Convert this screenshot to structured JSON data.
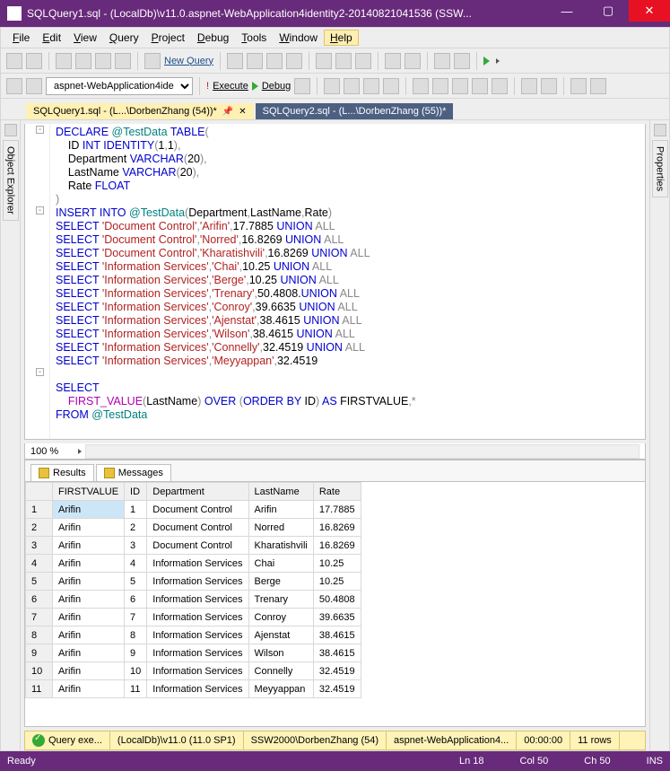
{
  "title": "SQLQuery1.sql - (LocalDb)\\v11.0.aspnet-WebApplication4identity2-20140821041536 (SSW...",
  "menu": [
    "File",
    "Edit",
    "View",
    "Query",
    "Project",
    "Debug",
    "Tools",
    "Window",
    "Help"
  ],
  "toolbar2": {
    "db": "aspnet-WebApplication4ide",
    "execute": "Execute",
    "debug": "Debug",
    "newquery": "New Query"
  },
  "tabs": [
    {
      "label": "SQLQuery1.sql - (L...\\DorbenZhang (54))*",
      "active": true
    },
    {
      "label": "SQLQuery2.sql - (L...\\DorbenZhang (55))*",
      "active": false
    }
  ],
  "side": {
    "left": "Object Explorer",
    "right": "Properties"
  },
  "zoom": "100 %",
  "code_lines": [
    {
      "t": "DECLARE @TestData TABLE(",
      "cls": "kw",
      "var": "@TestData",
      "tail": " TABLE(",
      "indent": 0,
      "out": true
    },
    {
      "raw": "    ID INT IDENTITY(1,1),"
    },
    {
      "raw": "    Department VARCHAR(20),"
    },
    {
      "raw": "    LastName VARCHAR(20),"
    },
    {
      "raw": "    Rate FLOAT"
    },
    {
      "raw": ")"
    },
    {
      "ins": true,
      "dept": "Document Control",
      "last": "Arifin",
      "rate": "17.7885"
    },
    {
      "dept": "Document Control",
      "last": "Norred",
      "rate": "16.8269"
    },
    {
      "dept": "Document Control",
      "last": "Kharatishvili",
      "rate": "16.8269"
    },
    {
      "dept": "Information Services",
      "last": "Chai",
      "rate": "10.25"
    },
    {
      "dept": "Information Services",
      "last": "Berge",
      "rate": "10.25"
    },
    {
      "dept": "Information Services",
      "last": "Trenary",
      "rate": "50.4808",
      "dot": true
    },
    {
      "dept": "Information Services",
      "last": "Conroy",
      "rate": "39.6635"
    },
    {
      "dept": "Information Services",
      "last": "Ajenstat",
      "rate": "38.4615"
    },
    {
      "dept": "Information Services",
      "last": "Wilson",
      "rate": "38.4615"
    },
    {
      "dept": "Information Services",
      "last": "Connelly",
      "rate": "32.4519"
    },
    {
      "dept": "Information Services",
      "last": "Meyyappan",
      "rate": "32.4519",
      "noall": true
    }
  ],
  "select_tail": {
    "l1": "SELECT",
    "l2": "    FIRST_VALUE(LastName) OVER (ORDER BY ID) AS FIRSTVALUE,*",
    "l3": "FROM @TestData"
  },
  "results_tabs": [
    "Results",
    "Messages"
  ],
  "grid": {
    "cols": [
      "",
      "FIRSTVALUE",
      "ID",
      "Department",
      "LastName",
      "Rate"
    ],
    "rows": [
      [
        "1",
        "Arifin",
        "1",
        "Document Control",
        "Arifin",
        "17.7885"
      ],
      [
        "2",
        "Arifin",
        "2",
        "Document Control",
        "Norred",
        "16.8269"
      ],
      [
        "3",
        "Arifin",
        "3",
        "Document Control",
        "Kharatishvili",
        "16.8269"
      ],
      [
        "4",
        "Arifin",
        "4",
        "Information Services",
        "Chai",
        "10.25"
      ],
      [
        "5",
        "Arifin",
        "5",
        "Information Services",
        "Berge",
        "10.25"
      ],
      [
        "6",
        "Arifin",
        "6",
        "Information Services",
        "Trenary",
        "50.4808"
      ],
      [
        "7",
        "Arifin",
        "7",
        "Information Services",
        "Conroy",
        "39.6635"
      ],
      [
        "8",
        "Arifin",
        "8",
        "Information Services",
        "Ajenstat",
        "38.4615"
      ],
      [
        "9",
        "Arifin",
        "9",
        "Information Services",
        "Wilson",
        "38.4615"
      ],
      [
        "10",
        "Arifin",
        "10",
        "Information Services",
        "Connelly",
        "32.4519"
      ],
      [
        "11",
        "Arifin",
        "11",
        "Information Services",
        "Meyyappan",
        "32.4519"
      ]
    ]
  },
  "status_yellow": [
    "Query exe...",
    "(LocalDb)\\v11.0 (11.0 SP1)",
    "SSW2000\\DorbenZhang (54)",
    "aspnet-WebApplication4...",
    "00:00:00",
    "11 rows"
  ],
  "status": {
    "ready": "Ready",
    "ln": "Ln 18",
    "col": "Col 50",
    "ch": "Ch 50",
    "ins": "INS"
  }
}
